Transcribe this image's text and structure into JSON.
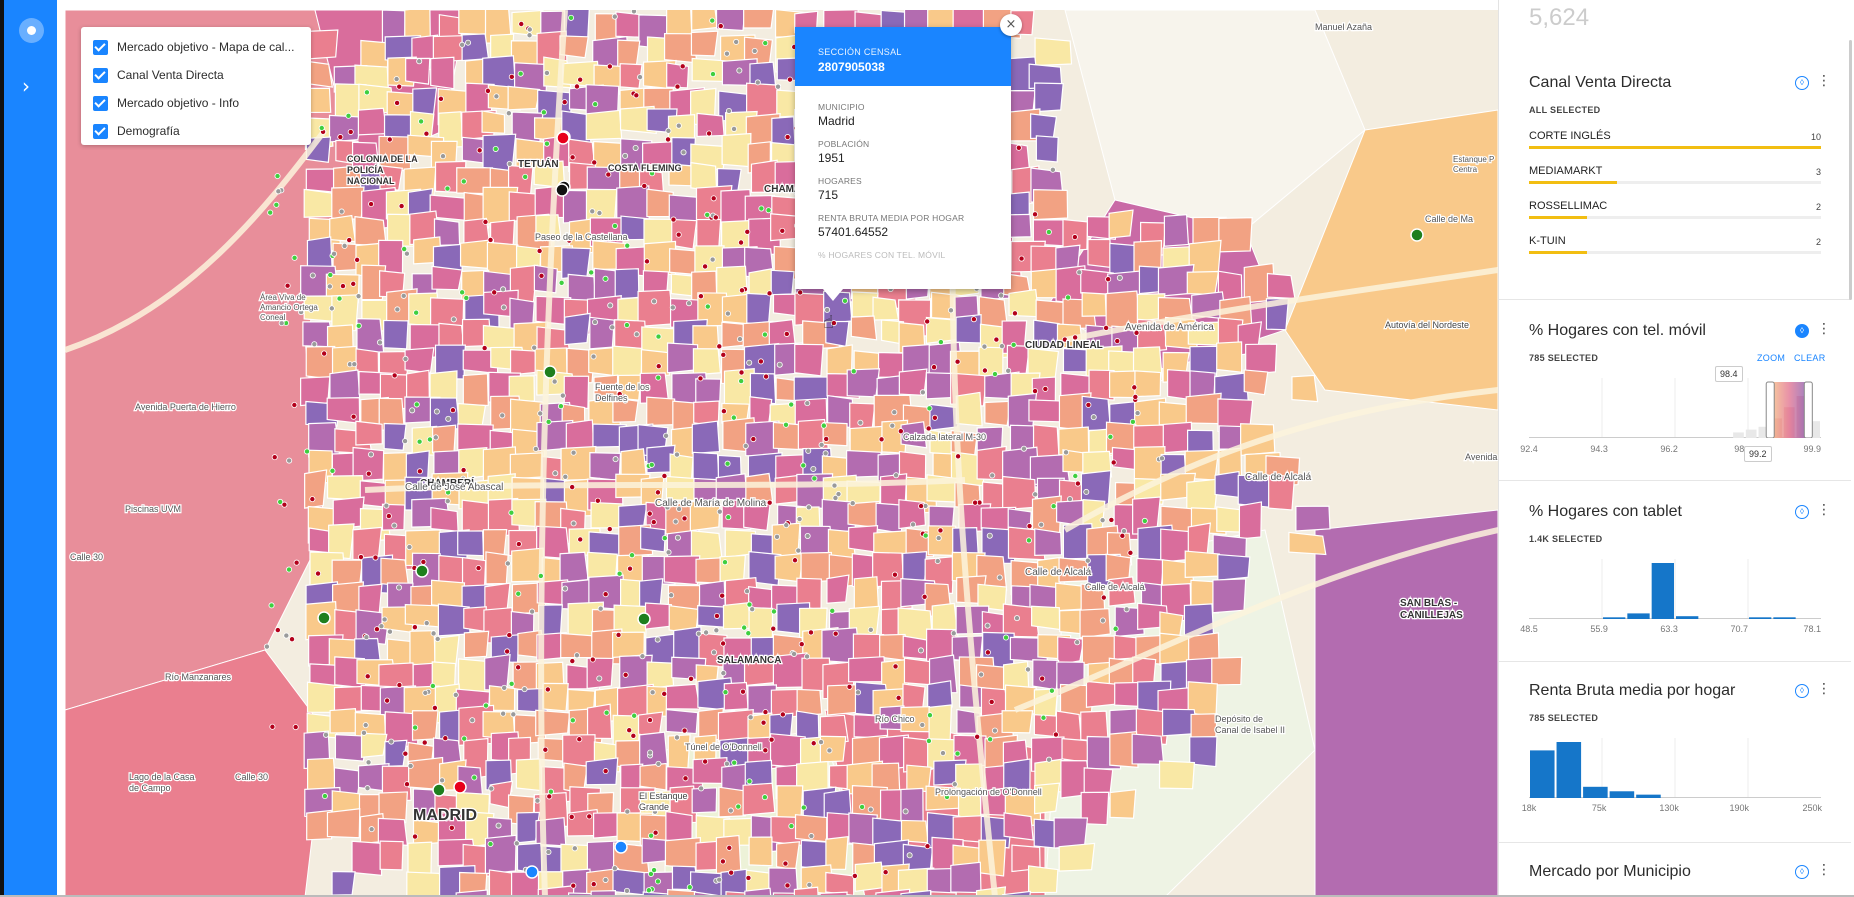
{
  "layers_panel": {
    "items": [
      {
        "label": "Mercado objetivo - Mapa de cal...",
        "checked": true
      },
      {
        "label": "Canal Venta Directa",
        "checked": true
      },
      {
        "label": "Mercado objetivo - Info",
        "checked": true
      },
      {
        "label": "Demografía",
        "checked": true
      }
    ]
  },
  "popup": {
    "header_label": "SECCIÓN CENSAL",
    "header_value": "2807905038",
    "fields": [
      {
        "label": "MUNICIPIO",
        "value": "Madrid"
      },
      {
        "label": "POBLACIÓN",
        "value": "1951"
      },
      {
        "label": "HOGARES",
        "value": "715"
      },
      {
        "label": "RENTA BRUTA MEDIA POR HOGAR",
        "value": "57401.64552"
      }
    ],
    "faded_label": "% HOGARES CON TEL. MÓVIL",
    "close_glyph": "×"
  },
  "map_labels": [
    "COLONIA DE LA\nPOLICÍA\nNACIONAL",
    "TETUÁN",
    "COSTA FLEMING",
    "CHAMARTÍN",
    "CIUDAD LINEAL",
    "CHAMBERÍ",
    "SALAMANCA",
    "MADRID",
    "SAN BLAS -\nCANILLEJAS",
    "Avenida de América",
    "Calle de Alcalá",
    "Calle de José Abascal",
    "Calle de María de Molina",
    "Calle de Alcalá",
    "Avenida Puerta de Hierro",
    "Río Manzanares",
    "Calle 30",
    "El Estanque\nGrande",
    "Autovía del Nordeste",
    "Fuente de los\nDelfines",
    "Depósito de\nCanal de Isabel II",
    "Lago de la Casa\nde Campo",
    "Piscinas UVM",
    "Estanque P\nCentra",
    "Calle de Ma",
    "Prolongación de O'Donnell",
    "Calzada lateral M-30",
    "Paseo de la Castellana",
    "Río Chico",
    "Área Viva de\nAmancio Ortega\nConeal",
    "Calle de Alcalá",
    "Avenida de Canillejas a Vicálvaro",
    "Calle 30",
    "Túnel de O'Donnell",
    "Manuel Azaña"
  ],
  "sidebar": {
    "top_value": "5,624",
    "widgets": [
      {
        "title": "Canal Venta Directa",
        "subtitle": "ALL SELECTED",
        "icon": "filter-icon",
        "categories": [
          {
            "name": "CORTE INGLÉS",
            "count": 10
          },
          {
            "name": "MEDIAMARKT",
            "count": 3
          },
          {
            "name": "ROSSELLIMAC",
            "count": 2
          },
          {
            "name": "K-TUIN",
            "count": 2
          }
        ]
      },
      {
        "title": "% Hogares con tel. móvil",
        "subtitle": "785 SELECTED",
        "zoom_label": "ZOOM",
        "clear_label": "CLEAR",
        "icon": "filter-icon",
        "range_min_label": "98.4",
        "range_max_label": "99.2",
        "ticks": [
          "92.4",
          "94.3",
          "96.2",
          "98",
          "99.9"
        ],
        "histogram": [
          0,
          0,
          0,
          0,
          0,
          0,
          0,
          0,
          0,
          0,
          0,
          0,
          0,
          0,
          0,
          0,
          0.1,
          0.15,
          0.2,
          0.35,
          0.55,
          0.75,
          0.3
        ]
      },
      {
        "title": "% Hogares con tablet",
        "subtitle": "1.4K SELECTED",
        "icon": "filter-icon",
        "ticks": [
          "48.5",
          "55.9",
          "63.3",
          "70.7",
          "78.1"
        ],
        "histogram": [
          0,
          0,
          0,
          0.03,
          0.1,
          1.0,
          0.05,
          0,
          0,
          0.03,
          0.03,
          0
        ]
      },
      {
        "title": "Renta Bruta media por hogar",
        "subtitle": "785 SELECTED",
        "icon": "filter-icon",
        "ticks": [
          "18k",
          "75k",
          "130k",
          "190k",
          "250k"
        ],
        "histogram": [
          0.85,
          1.0,
          0.2,
          0.12,
          0.06,
          0,
          0,
          0,
          0,
          0,
          0
        ]
      },
      {
        "title": "Mercado por Municipio",
        "icon": "filter-icon"
      }
    ]
  },
  "colors": {
    "accent": "#1a85ff",
    "category_bar": "#f2be12",
    "histogram_bar": "#1576c9",
    "choropleth": [
      "#f9e8a5",
      "#f9c98a",
      "#f2a283",
      "#ea7f8f",
      "#d96d9c",
      "#b36cb0",
      "#8a69b8"
    ]
  }
}
